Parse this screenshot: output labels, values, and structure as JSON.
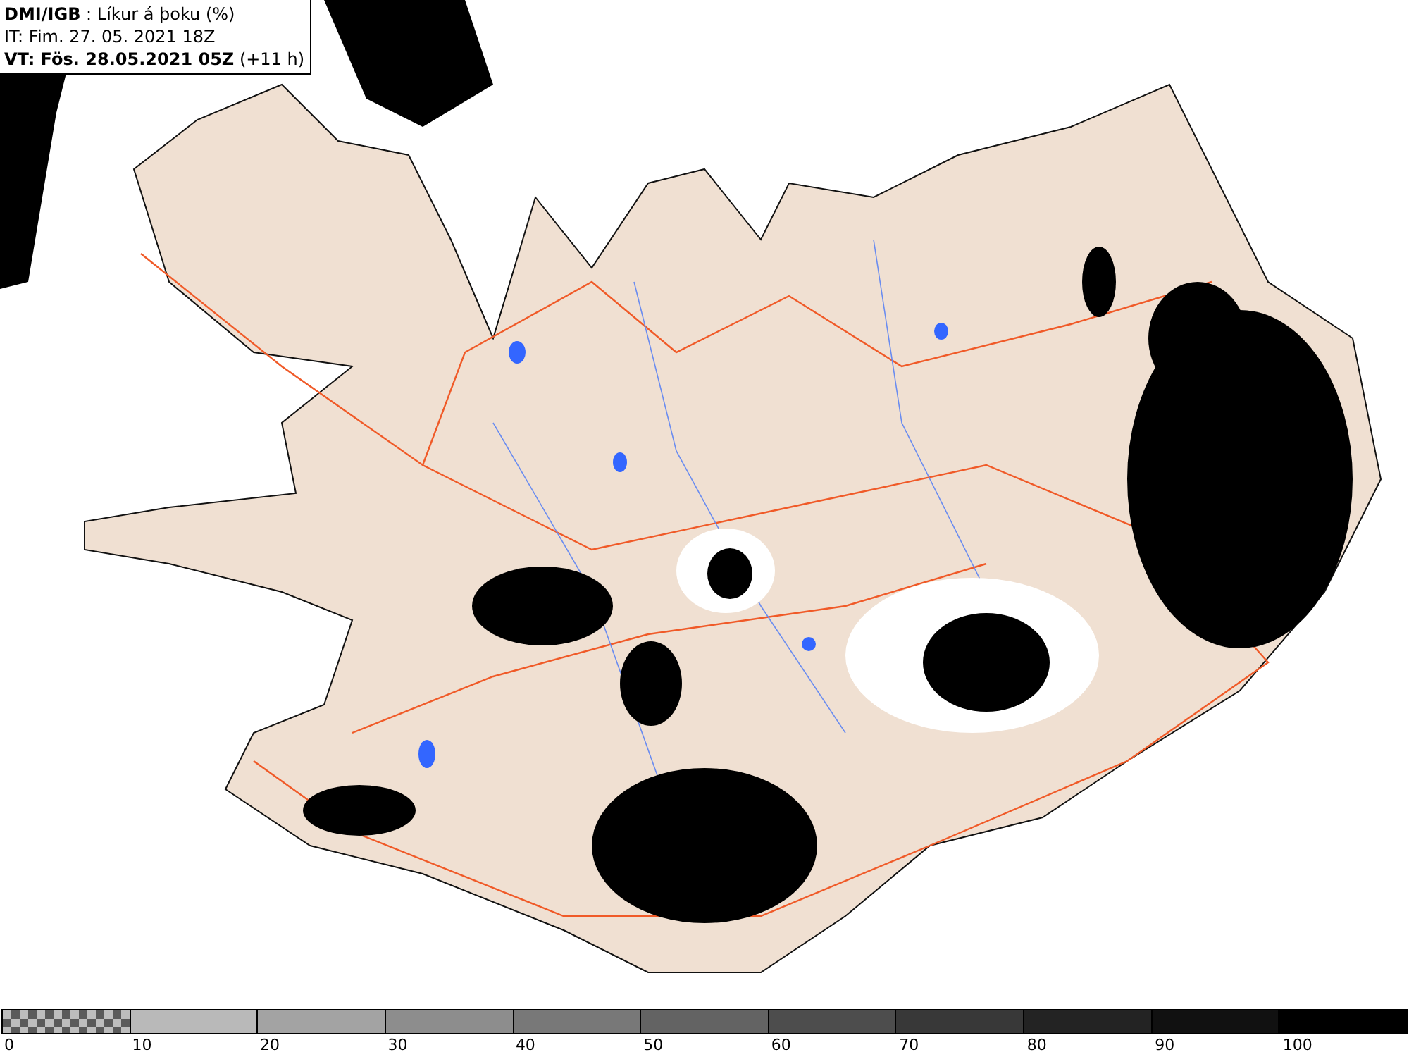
{
  "header": {
    "lines": [
      "**DMI/IGB** : Líkur á þoku (%)",
      "IT: Fim. 27. 05. 2021 18Z",
      "**VT: Fös. 28.05.2021 05Z** (+11 h)"
    ]
  },
  "legend": {
    "bins": [
      {
        "label": "0",
        "kind": "checker",
        "color": "#5a5a5a"
      },
      {
        "label": "10",
        "kind": "solid",
        "color": "#b9b9b9"
      },
      {
        "label": "20",
        "kind": "solid",
        "color": "#a3a3a3"
      },
      {
        "label": "30",
        "kind": "solid",
        "color": "#8d8d8d"
      },
      {
        "label": "40",
        "kind": "solid",
        "color": "#787878"
      },
      {
        "label": "50",
        "kind": "solid",
        "color": "#636363"
      },
      {
        "label": "60",
        "kind": "solid",
        "color": "#4d4d4d"
      },
      {
        "label": "70",
        "kind": "solid",
        "color": "#383838"
      },
      {
        "label": "80",
        "kind": "solid",
        "color": "#232323"
      },
      {
        "label": "90",
        "kind": "solid",
        "color": "#111111"
      },
      {
        "label": "100",
        "kind": "solid",
        "color": "#000000"
      }
    ]
  }
}
